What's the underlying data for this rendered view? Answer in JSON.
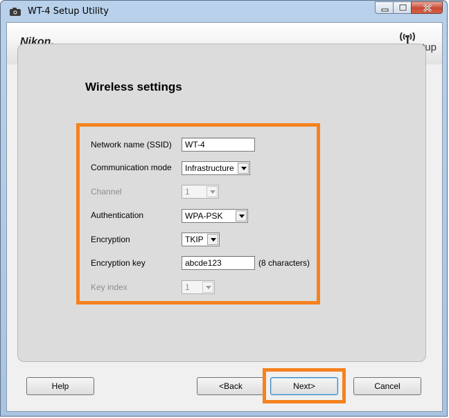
{
  "window": {
    "title": "WT-4 Setup Utility"
  },
  "header": {
    "brand": "Nikon.",
    "setup_logo_text": "Setup"
  },
  "page": {
    "title": "Wireless settings"
  },
  "form": {
    "ssid": {
      "label": "Network name (SSID)",
      "value": "WT-4"
    },
    "communication_mode": {
      "label": "Communication mode",
      "value": "Infrastructure"
    },
    "channel": {
      "label": "Channel",
      "value": "1",
      "enabled": false
    },
    "authentication": {
      "label": "Authentication",
      "value": "WPA-PSK"
    },
    "encryption": {
      "label": "Encryption",
      "value": "TKIP"
    },
    "encryption_key": {
      "label": "Encryption key",
      "value": "abcde123",
      "hint": "(8 characters)"
    },
    "key_index": {
      "label": "Key index",
      "value": "1",
      "enabled": false
    }
  },
  "buttons": {
    "help": "Help",
    "back": "<Back",
    "next": "Next>",
    "cancel": "Cancel"
  },
  "colors": {
    "highlight": "#f5821f",
    "title_bar": "#b9d1ea",
    "close_button": "#c74a35"
  },
  "icons": {
    "app": "camera-icon",
    "setup": "wireless-antenna-icon"
  }
}
